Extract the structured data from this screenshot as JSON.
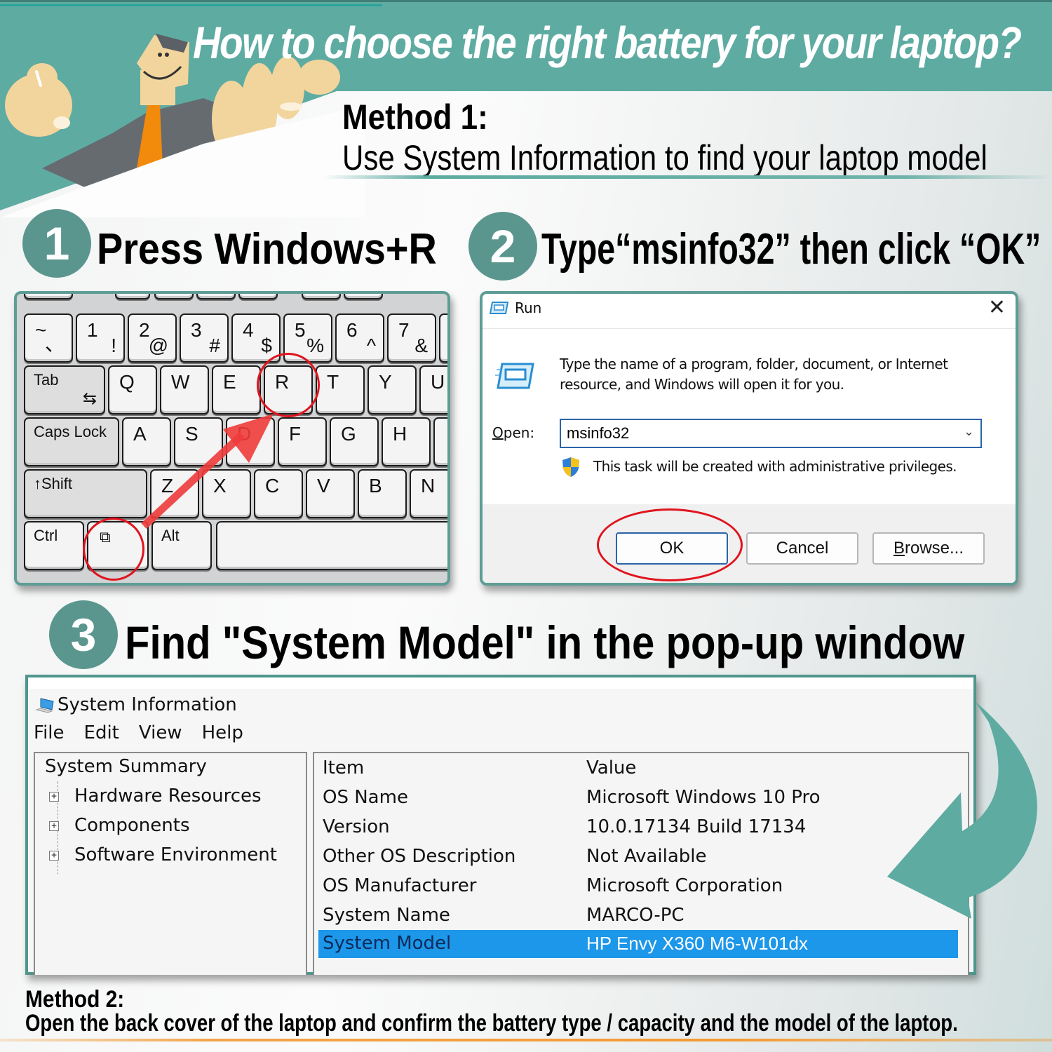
{
  "header": {
    "title": "How to choose the right battery for your laptop?",
    "method1_title": "Method 1:",
    "method1_subtitle": "Use System Information to find your laptop model"
  },
  "colors": {
    "teal": "#5eaba2",
    "teal_dark": "#5a968e",
    "highlight_blue": "#1c97e9",
    "annotation_red": "#e0141e",
    "accent_orange": "#f39a34"
  },
  "steps": [
    {
      "number": "1",
      "label": "Press Windows+R"
    },
    {
      "number": "2",
      "label": "Type“msinfo32” then click “OK”"
    },
    {
      "number": "3",
      "label": "Find \"System Model\" in the pop-up window"
    }
  ],
  "keyboard": {
    "row_numbers": [
      {
        "top": "~",
        "bottom": "、"
      },
      {
        "top": "1",
        "bottom": "!"
      },
      {
        "top": "2",
        "bottom": "@"
      },
      {
        "top": "3",
        "bottom": "#"
      },
      {
        "top": "4",
        "bottom": "$"
      },
      {
        "top": "5",
        "bottom": "%"
      },
      {
        "top": "6",
        "bottom": "^"
      },
      {
        "top": "7",
        "bottom": "&"
      }
    ],
    "row_qwerty": [
      "Q",
      "W",
      "E",
      "R",
      "T",
      "Y",
      "U"
    ],
    "row_home": [
      "A",
      "S",
      "D",
      "F",
      "G",
      "H"
    ],
    "row_bottom": [
      "Z",
      "X",
      "C",
      "V",
      "B",
      "N"
    ],
    "tab": "Tab",
    "tab_arrow": "⇆",
    "caps": "Caps Lock",
    "shift": "↑Shift",
    "ctrl": "Ctrl",
    "win": "⧉",
    "alt": "Alt",
    "highlighted_keys": [
      "Windows",
      "R"
    ]
  },
  "run_dialog": {
    "title": "Run",
    "close": "✕",
    "description": "Type the name of a program, folder, document, or Internet resource, and Windows will open it for you.",
    "open_label_mnemonic": "O",
    "open_label_rest": "pen:",
    "open_value": "msinfo32",
    "dropdown_icon": "⌄",
    "admin_note": "This task will be created with administrative privileges.",
    "buttons": {
      "ok": "OK",
      "cancel": "Cancel",
      "browse_mnemonic": "B",
      "browse_rest": "rowse..."
    }
  },
  "system_info": {
    "title": "System Information",
    "menu": [
      "File",
      "Edit",
      "View",
      "Help"
    ],
    "tree": {
      "root": "System Summary",
      "children": [
        "Hardware Resources",
        "Components",
        "Software Environment"
      ],
      "expand_symbol": "+"
    },
    "columns": [
      "Item",
      "Value"
    ],
    "rows": [
      {
        "item": "OS Name",
        "value": "Microsoft Windows 10 Pro"
      },
      {
        "item": "Version",
        "value": "10.0.17134 Build 17134"
      },
      {
        "item": "Other OS Description",
        "value": "Not Available"
      },
      {
        "item": "OS Manufacturer",
        "value": "Microsoft Corporation"
      },
      {
        "item": "System Name",
        "value": "MARCO-PC"
      },
      {
        "item": "System Model",
        "value": "HP Envy X360 M6-W101dx",
        "selected": true
      }
    ]
  },
  "footer": {
    "method2_title": "Method 2:",
    "method2_text": "Open the back cover of the laptop and confirm the battery type / capacity and the model of the laptop."
  }
}
